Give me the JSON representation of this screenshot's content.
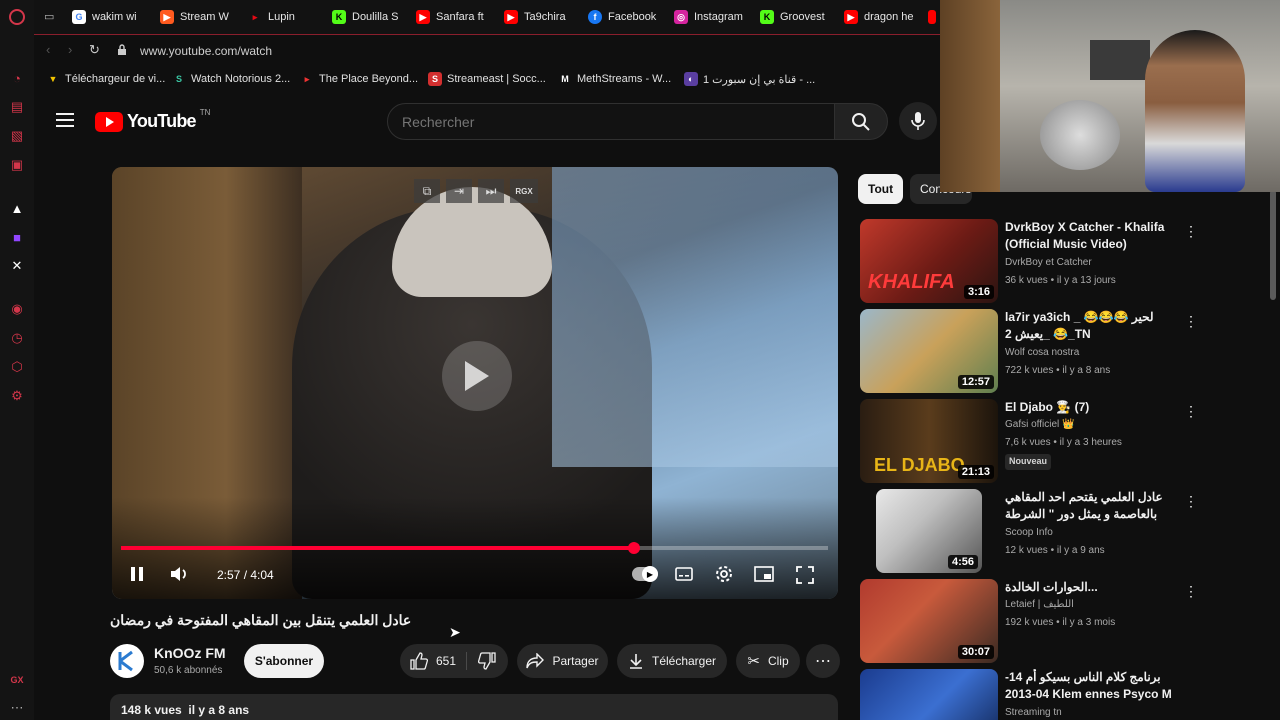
{
  "colors": {
    "yt_red": "#ff0000",
    "bg": "#0f0f0f",
    "progress": "#ff0033",
    "opera_red": "#d3364a"
  },
  "browser": {
    "tabs": [
      {
        "label": "wakim wi",
        "icon": "google-icon"
      },
      {
        "label": "Stream W",
        "icon": "stream-icon"
      },
      {
        "label": "Lupin",
        "icon": "lupin-icon"
      },
      {
        "label": "Doulilla S",
        "icon": "kick-icon"
      },
      {
        "label": "Sanfara ft",
        "icon": "youtube-icon"
      },
      {
        "label": "Ta9chira",
        "icon": "youtube-icon"
      },
      {
        "label": "Facebook",
        "icon": "facebook-icon"
      },
      {
        "label": "Instagram",
        "icon": "instagram-icon"
      },
      {
        "label": "Groovest",
        "icon": "kick-icon"
      },
      {
        "label": "dragon he",
        "icon": "youtube-icon"
      }
    ],
    "url": "www.youtube.com/watch",
    "bookmarks": [
      "Téléchargeur de vi...",
      "Watch Notorious 2...",
      "The Place Beyond...",
      "Streameast | Socc...",
      "MethStreams - W...",
      "قناة بي إن سبورت 1 - ..."
    ],
    "sidebar_bottom": "GX"
  },
  "youtube": {
    "logo_text": "YouTube",
    "country": "TN",
    "search_placeholder": "Rechercher"
  },
  "player": {
    "time_current": "2:57",
    "time_total": "4:04",
    "time_display": "2:57 / 4:04",
    "progress_fraction": 0.7254,
    "overlay_buttons": [
      "popout-icon",
      "exit-icon",
      "skip-icon",
      "RGX"
    ],
    "overlay_rgx": "RGX"
  },
  "video": {
    "title": "عادل العلمي يتنقل بين المقاهي المفتوحة في رمضان",
    "channel": "KnOOz FM",
    "subscribers": "50,6 k abonnés",
    "subscribe_label": "S'abonner",
    "likes": "651",
    "share_label": "Partager",
    "download_label": "Télécharger",
    "clip_label": "Clip",
    "views_date": "148 k vues  il y a 8 ans"
  },
  "chips": [
    "Tout",
    "Concours"
  ],
  "recommendations": [
    {
      "title": "DvrkBoy X Catcher - Khalifa (Official Music Video)",
      "channel": "DvrkBoy et Catcher",
      "meta": "36 k vues • il y a 13 jours",
      "duration": "3:16",
      "badge": ""
    },
    {
      "title": "la7ir ya3ich _ 😂😂😂 لحير يعيش 2_ 😂_TN",
      "channel": "Wolf cosa nostra",
      "meta": "722 k vues • il y a 8 ans",
      "duration": "12:57",
      "badge": ""
    },
    {
      "title": "El Djabo 👨‍🍳 (7)",
      "channel": "Gafsi officiel 👑",
      "meta": "7,6 k vues • il y a 3 heures",
      "duration": "21:13",
      "badge": "Nouveau"
    },
    {
      "title": "عادل العلمي يقتحم احد المقاهي بالعاصمة و يمثل دور \" الشرطة الدينية\"",
      "channel": "Scoop Info",
      "meta": "12 k vues • il y a 9 ans",
      "duration": "4:56",
      "badge": ""
    },
    {
      "title": "الحوارات الخالدة...",
      "channel": "Letaief | اللطيف",
      "meta": "192 k vues • il y a 3 mois",
      "duration": "30:07",
      "badge": ""
    },
    {
      "title": "برنامج كلام الناس بسيكو أم 14-04-2013 Klem ennes Psyco M",
      "channel": "Streaming tn",
      "meta": "",
      "duration": "",
      "badge": ""
    }
  ]
}
